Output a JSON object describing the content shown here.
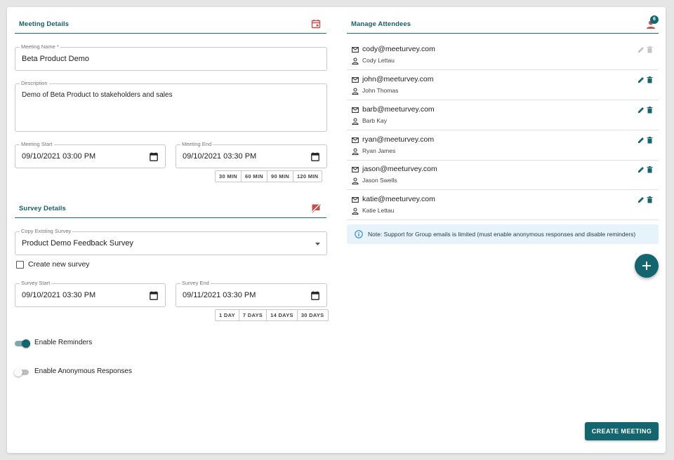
{
  "meeting_section": {
    "title": "Meeting Details",
    "name_label": "Meeting Name *",
    "name_value": "Beta Product Demo",
    "description_label": "Description",
    "description_value": "Demo of Beta Product to stakeholders and sales",
    "start_label": "Meeting Start",
    "start_value": "09/10/2021 03:00 PM",
    "end_label": "Meeting End",
    "end_value": "09/10/2021 03:30 PM",
    "durations": [
      "30 MIN",
      "60 MIN",
      "90 MIN",
      "120 MIN"
    ]
  },
  "survey_section": {
    "title": "Survey Details",
    "copy_label": "Copy Existing Survey",
    "copy_value": "Product Demo Feedback Survey",
    "create_new_label": "Create new survey",
    "start_label": "Survey Start",
    "start_value": "09/10/2021 03:30 PM",
    "end_label": "Survey End",
    "end_value": "09/11/2021 03:30 PM",
    "durations": [
      "1 DAY",
      "7 DAYS",
      "14 DAYS",
      "30 DAYS"
    ],
    "reminders_label": "Enable Reminders",
    "reminders_on": true,
    "anonymous_label": "Enable Anonymous Responses",
    "anonymous_on": false
  },
  "attendees_section": {
    "title": "Manage Attendees",
    "count": "6",
    "attendees": [
      {
        "email": "cody@meeturvey.com",
        "name": "Cody Lettau",
        "editable": false
      },
      {
        "email": "john@meeturvey.com",
        "name": "John Thomas",
        "editable": true
      },
      {
        "email": "barb@meeturvey.com",
        "name": "Barb Kay",
        "editable": true
      },
      {
        "email": "ryan@meeturvey.com",
        "name": "Ryan James",
        "editable": true
      },
      {
        "email": "jason@meeturvey.com",
        "name": "Jason Swells",
        "editable": true
      },
      {
        "email": "katie@meeturvey.com",
        "name": "Katie Lettau",
        "editable": true
      }
    ],
    "note": "Note: Support for Group emails is limited (must enable anonymous responses and disable reminders)"
  },
  "actions": {
    "create_label": "CREATE MEETING"
  },
  "colors": {
    "primary": "#15656f",
    "accent_red": "#c0504d",
    "note_bg": "#e6f3fb"
  },
  "icons": {
    "meeting": "calendar-icon",
    "survey": "comment-off-icon",
    "attendees": "person-icon",
    "email": "mail-icon",
    "name": "person-outline-icon",
    "edit": "pencil-icon",
    "delete": "trash-icon",
    "info": "info-icon",
    "add": "plus-icon"
  }
}
